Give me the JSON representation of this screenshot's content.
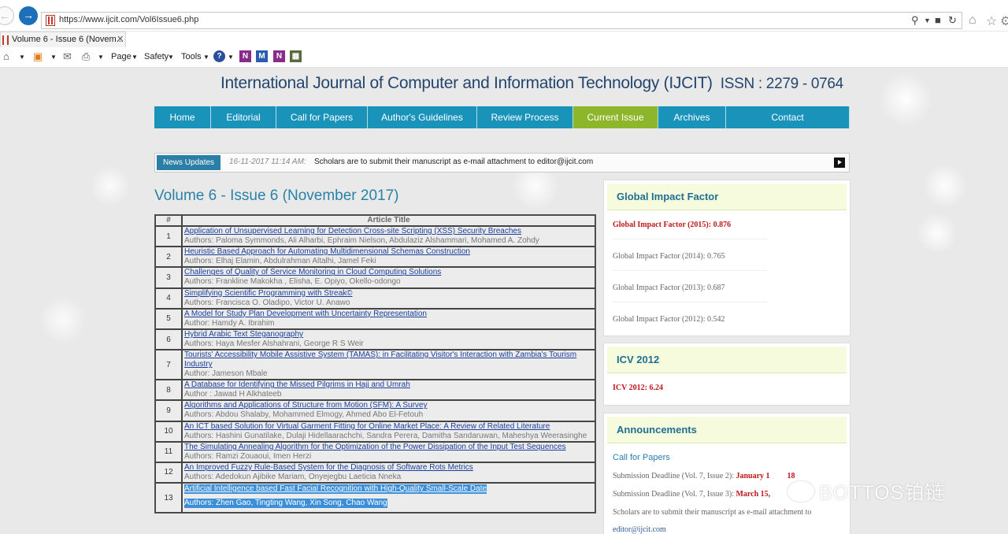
{
  "browser": {
    "url": "https://www.ijcit.com/Vol6Issue6.php",
    "tab_title": "Volume 6 - Issue 6 (Novem...",
    "tab_close": "✕",
    "commands": [
      "Page",
      "Safety",
      "Tools"
    ]
  },
  "site": {
    "title": "International Journal of Computer and Information Technology (IJCIT)",
    "issn": "ISSN : 2279 - 0764"
  },
  "nav": [
    {
      "label": "Home",
      "w": 72
    },
    {
      "label": "Editorial",
      "w": 83
    },
    {
      "label": "Call for Papers",
      "w": 116
    },
    {
      "label": "Author's Guidelines",
      "w": 139
    },
    {
      "label": "Review Process",
      "w": 122
    },
    {
      "label": "Current Issue",
      "w": 108,
      "active": true
    },
    {
      "label": "Archives",
      "w": 86
    },
    {
      "label": "Contact",
      "w": 157
    }
  ],
  "news": {
    "label": "News Updates",
    "date": "16-11-2017 11:14 AM:",
    "text": "Scholars are to submit their manuscript as e-mail attachment to editor@ijcit.com"
  },
  "volume_title": "Volume 6 - Issue 6 (November 2017)",
  "table": {
    "header_num": "#",
    "header_title": "Article Title",
    "rows": [
      {
        "num": "1",
        "title": "Application of Unsupervised Learning for Detection Cross-site Scripting (XSS) Security Breaches",
        "authors": "Authors: Paloma Symmonds, Ali Alharbi, Ephraim Nielson, Abdulaziz Alshammari, Mohamed A. Zohdy"
      },
      {
        "num": "2",
        "title": "Heuristic Based Approach for Automating Multidimensional Schemas Construction",
        "authors": "Authors: Elhaj Elamin, Abdulrahman Altalhi, Jamel Feki"
      },
      {
        "num": "3",
        "title": "Challenges of Quality of Service Monitoring in Cloud Computing Solutions",
        "authors": "Authors: Frankline Makokha , Elisha, E. Opiyo, Okello-odongo"
      },
      {
        "num": "4",
        "title": "Simplifying Scientific Programming with Streak©",
        "authors": "Authors: Francisca O. Oladipo, Victor U. Anawo"
      },
      {
        "num": "5",
        "title": "A Model for Study Plan Development with Uncertainty Representation",
        "authors": "Author: Hamdy A. Ibrahim"
      },
      {
        "num": "6",
        "title": "Hybrid Arabic Text Steganography",
        "authors": "Authors: Haya Mesfer Alshahrani, George R S Weir"
      },
      {
        "num": "7",
        "title": "Tourists' Accessibility Mobile Assistive System (TAMAS): in Facilitating Visitor's Interaction with Zambia's Tourism Industry",
        "authors": "Author: Jameson Mbale",
        "tall": true
      },
      {
        "num": "8",
        "title": "A Database for Identifying the Missed Pilgrims in Hajj and Umrah",
        "authors": "Author : Jawad H Alkhateeb"
      },
      {
        "num": "9",
        "title": "Algorithms and Applications of Structure from Motion (SFM): A Survey",
        "authors": "Authors: Abdou Shalaby, Mohammed Elmogy, Ahmed Abo El-Fetouh"
      },
      {
        "num": "10",
        "title": "An ICT based Solution for Virtual Garment Fitting for Online Market Place: A Review of Related Literature",
        "authors": "Authors: Hashini Gunatilake, Dulaji Hidellaarachchi, Sandra Perera, Damitha Sandaruwan, Maheshya Weerasinghe"
      },
      {
        "num": "11",
        "title": "The Simulating Annealing Algorithm for the Optimization of the Power Dissipation of the Input Test Sequences",
        "authors": "Authors: Ramzi Zouaoui, Imen Herzi"
      },
      {
        "num": "12",
        "title": "An Improved Fuzzy Rule-Based System for the Diagnosis of Software Rots Metrics",
        "authors": "Authors: Adedokun Ajibike Mariam, Onyejegbu Laeticia Nneka"
      },
      {
        "num": "13",
        "title": "Artificial Intelligence based Fast Facial Recognition with High-Quality Small-Scale Date",
        "authors": "Authors: Zhen Gao, Tingting Wang, Xin Song, Chao Wang",
        "selected": true
      }
    ]
  },
  "impact": {
    "heading": "Global Impact Factor",
    "highlight": "Global Impact Factor (2015): 0.876",
    "lines": [
      "Global Impact Factor (2014): 0.765",
      "Global Impact Factor (2013): 0.687",
      "Global Impact Factor (2012): 0.542"
    ]
  },
  "icv": {
    "heading": "ICV 2012",
    "value": "ICV 2012: 6.24"
  },
  "announcements": {
    "heading": "Announcements",
    "link": "Call for Papers",
    "deadline1_label": "Submission Deadline (Vol. 7, Issue 2):",
    "deadline1_date": "January 1",
    "deadline1_suffix": "18",
    "deadline2_label": "Submission Deadline (Vol. 7, Issue 3):",
    "deadline2_date": "March 15,",
    "note": "Scholars are to submit their manuscript as e-mail attachment to",
    "email": "editor@ijcit.com"
  },
  "watermark": "BOTTOS铂链"
}
